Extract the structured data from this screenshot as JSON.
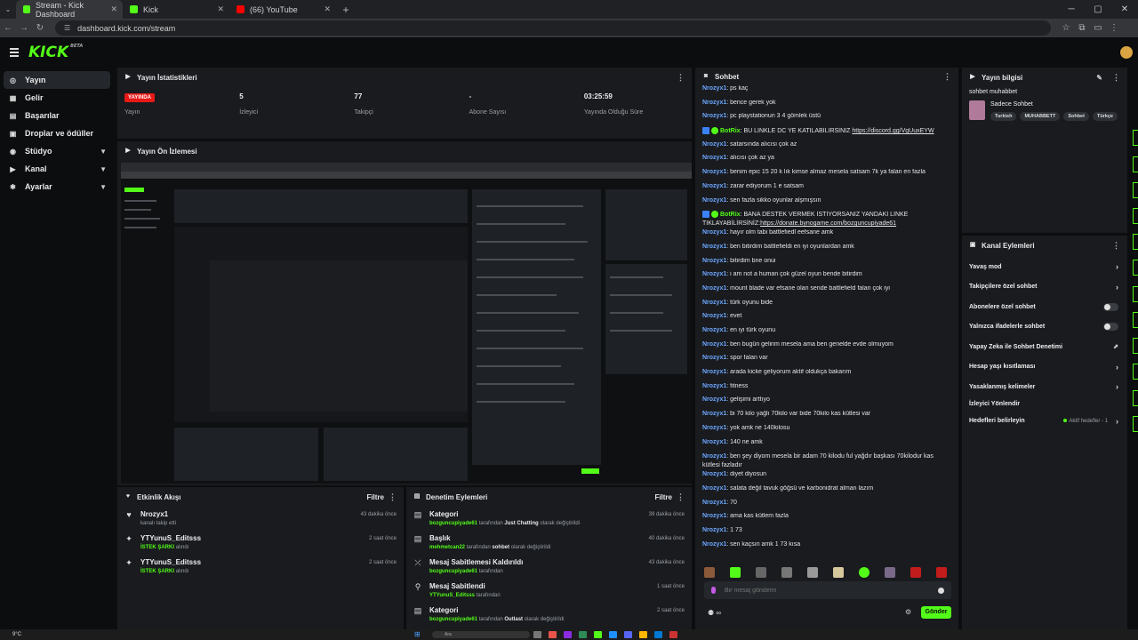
{
  "browser": {
    "tabs": [
      {
        "title": "Stream - Kick Dashboard",
        "color": "#53fc18",
        "active": true
      },
      {
        "title": "Kick",
        "color": "#53fc18",
        "active": false
      },
      {
        "title": "(66) YouTube",
        "color": "#ff0000",
        "active": false
      }
    ],
    "url": "dashboard.kick.com/stream"
  },
  "header": {
    "logo": "KICK",
    "beta": "BETA"
  },
  "sidebar": {
    "items": [
      {
        "label": "Yayın",
        "icon": "broadcast-icon",
        "glyph": "((•))",
        "active": true
      },
      {
        "label": "Gelir",
        "icon": "revenue-icon",
        "glyph": "▦"
      },
      {
        "label": "Başarılar",
        "icon": "achievements-icon",
        "glyph": "▤"
      },
      {
        "label": "Droplar ve ödüller",
        "icon": "drops-icon",
        "glyph": "▣"
      },
      {
        "label": "Stüdyo",
        "icon": "studio-icon",
        "glyph": "◉",
        "chevron": true
      },
      {
        "label": "Kanal",
        "icon": "channel-icon",
        "glyph": "▶",
        "chevron": true
      },
      {
        "label": "Ayarlar",
        "icon": "settings-icon",
        "glyph": "✱",
        "chevron": true
      }
    ]
  },
  "stats_panel": {
    "title": "Yayın İstatistikleri",
    "stats": [
      {
        "value": "YAYINDA",
        "label": "Yayın"
      },
      {
        "value": "5",
        "label": "İzleyici"
      },
      {
        "value": "77",
        "label": "Takipçi"
      },
      {
        "value": "-",
        "label": "Abone Sayısı"
      },
      {
        "value": "03:25:59",
        "label": "Yayında Olduğu Süre"
      }
    ]
  },
  "preview_panel": {
    "title": "Yayın Ön İzlemesi"
  },
  "activity_panel": {
    "title": "Etkinlik Akışı",
    "filter": "Filtre",
    "items": [
      {
        "title": "Nrozyx1",
        "sub": "kanalı takip etti",
        "highlight": "",
        "time": "43 dakika önce",
        "icon": "heart-icon",
        "glyph": "♥"
      },
      {
        "title": "YTYunuS_Editsss",
        "sub": "alındı",
        "highlight": "İSTEK ŞARKI",
        "time": "2 saat önce",
        "icon": "reward-icon",
        "glyph": "✦"
      },
      {
        "title": "YTYunuS_Editsss",
        "sub": "alındı",
        "highlight": "İSTEK ŞARKI",
        "time": "2 saat önce",
        "icon": "reward-icon",
        "glyph": "✦"
      }
    ]
  },
  "mod_panel": {
    "title": "Denetim Eylemleri",
    "filter": "Filtre",
    "items": [
      {
        "title": "Kategori",
        "user": "bozguncupiyade61",
        "mid": "tarafından",
        "value": "Just Chatting",
        "end": "olarak değiştirildi",
        "time": "39 dakika önce",
        "icon": "category-icon",
        "glyph": "▤"
      },
      {
        "title": "Başlık",
        "user": "mehmetcan22",
        "mid": "tarafından",
        "value": "sohbet",
        "end": "olarak değiştirildi",
        "time": "40 dakika önce",
        "icon": "title-icon",
        "glyph": "▤"
      },
      {
        "title": "Mesaj Sabitlemesi Kaldırıldı",
        "user": "bozguncupiyade61",
        "mid": "tarafından",
        "value": "",
        "end": "",
        "time": "43 dakika önce",
        "icon": "unpin-icon",
        "glyph": "⤫"
      },
      {
        "title": "Mesaj Sabitlendi",
        "user": "YTYunuS_Editsss",
        "mid": "tarafından",
        "value": "",
        "end": "",
        "time": "1 saat önce",
        "icon": "pin-icon",
        "glyph": "⚲"
      },
      {
        "title": "Kategori",
        "user": "bozguncupiyade61",
        "mid": "tarafından",
        "value": "Outlast",
        "end": "olarak değiştirildi",
        "time": "2 saat önce",
        "icon": "category-icon",
        "glyph": "▤"
      }
    ]
  },
  "chat": {
    "title": "Sohbet",
    "messages": [
      {
        "user": "Nrozyx1",
        "text": "ps kaç"
      },
      {
        "user": "Nrozyx1",
        "text": "bence gerek yok"
      },
      {
        "user": "Nrozyx1",
        "text": "pc playstationun 3 4 gömlek üstü"
      },
      {
        "user": "BotRix",
        "bot": true,
        "text": "BU LİNKLE DC YE KATILABİLİRSİNİZ",
        "link": "https://discord.gg/VgUuxEYW"
      },
      {
        "user": "Nrozyx1",
        "text": "satarsında alıcısı çok az"
      },
      {
        "user": "Nrozyx1",
        "text": "alıcısı çok az ya"
      },
      {
        "user": "Nrozyx1",
        "text": "benim epic 15 20 k lık kimse almaz mesela satsam 7k ya falan en fazla"
      },
      {
        "user": "Nrozyx1",
        "text": "zarar ediyorum 1 e satsam"
      },
      {
        "user": "Nrozyx1",
        "text": "sen fazla sikko oyunlar alşmışsın"
      },
      {
        "user": "BotRix",
        "bot": true,
        "two": true,
        "text": "BANA DESTEK VERMEK İSTİYORSANIZ YANDAKİ LİNKE TIKLAYABİLİRSİNİZ:",
        "link": "https://donate.bynogame.com/bozguncupiyade61"
      },
      {
        "user": "Nrozyx1",
        "text": "hayır olm tabi battlefiedl eefsane amk"
      },
      {
        "user": "Nrozyx1",
        "text": "ben bitirdim battlefieldi en iyi oyunlardan amk"
      },
      {
        "user": "Nrozyx1",
        "text": "bitirdim bne onui"
      },
      {
        "user": "Nrozyx1",
        "text": "i am not a human çok güzel oyun bende bitirdim"
      },
      {
        "user": "Nrozyx1",
        "text": "mount blade var efsane olan sende battlefield falan çok iyi"
      },
      {
        "user": "Nrozyx1",
        "text": "türk oyunu bide"
      },
      {
        "user": "Nrozyx1",
        "text": "evet"
      },
      {
        "user": "Nrozyx1",
        "text": "en iyi türk oyunu"
      },
      {
        "user": "Nrozyx1",
        "text": "ben bugün gelirim mesela ama ben genelde evde olmuyom"
      },
      {
        "user": "Nrozyx1",
        "text": "spor falan var"
      },
      {
        "user": "Nrozyx1",
        "text": "arada kicke geliyorum aktif oldukça bakarım"
      },
      {
        "user": "Nrozyx1",
        "text": "fitness"
      },
      {
        "user": "Nrozyx1",
        "text": "gelişimi arttıyo"
      },
      {
        "user": "Nrozyx1",
        "text": "bi 70 kilo yağlı 70kilo var bide 70kilo kas kütlesi var"
      },
      {
        "user": "Nrozyx1",
        "text": "yok amk ne 140kilosu"
      },
      {
        "user": "Nrozyx1",
        "text": "140 ne amk"
      },
      {
        "user": "Nrozyx1",
        "two": true,
        "text": "ben şey diyom mesela bir adam 70 kilodu ful yağdır başkası 70kilodur kas kütlesi fazladır"
      },
      {
        "user": "Nrozyx1",
        "text": "diyet diyosun"
      },
      {
        "user": "Nrozyx1",
        "text": "salata değil tavuk göğsü ve karbonidrat alman lazım"
      },
      {
        "user": "Nrozyx1",
        "text": "70"
      },
      {
        "user": "Nrozyx1",
        "text": "ama kas kütlem fazla"
      },
      {
        "user": "Nrozyx1",
        "text": "1 73"
      },
      {
        "user": "Nrozyx1",
        "text": "sen kaçsın amk 1 73 kısa"
      }
    ],
    "input_placeholder": "Bir mesaj gönderin",
    "send_label": "Gönder"
  },
  "stream_info": {
    "title": "Yayın bilgisi",
    "stream_title": "sohbet muhabbet",
    "category": "Sadece Sohbet",
    "tags": [
      "Turkish",
      "MUHABBETT",
      "Sohbet",
      "Türkçe"
    ]
  },
  "channel_actions": {
    "title": "Kanal Eylemleri",
    "items": [
      {
        "label": "Yavaş mod",
        "type": "arrow"
      },
      {
        "label": "Takipçilere özel sohbet",
        "type": "arrow"
      },
      {
        "label": "Abonelere özel sohbet",
        "type": "toggle"
      },
      {
        "label": "Yalnızca ifadelerle sohbet",
        "type": "toggle"
      },
      {
        "label": "Yapay Zeka ile Sohbet Denetimi",
        "type": "external"
      },
      {
        "label": "Hesap yaşı kısıtlaması",
        "type": "arrow"
      },
      {
        "label": "Yasaklanmış kelimeler",
        "type": "arrow"
      },
      {
        "label": "İzleyici Yönlendir",
        "type": "none"
      },
      {
        "label": "Hedefleri belirleyin",
        "type": "arrow",
        "badge": "Aktif hedefler - 1"
      }
    ]
  },
  "taskbar": {
    "weather": "9°C",
    "search": "Ara"
  }
}
